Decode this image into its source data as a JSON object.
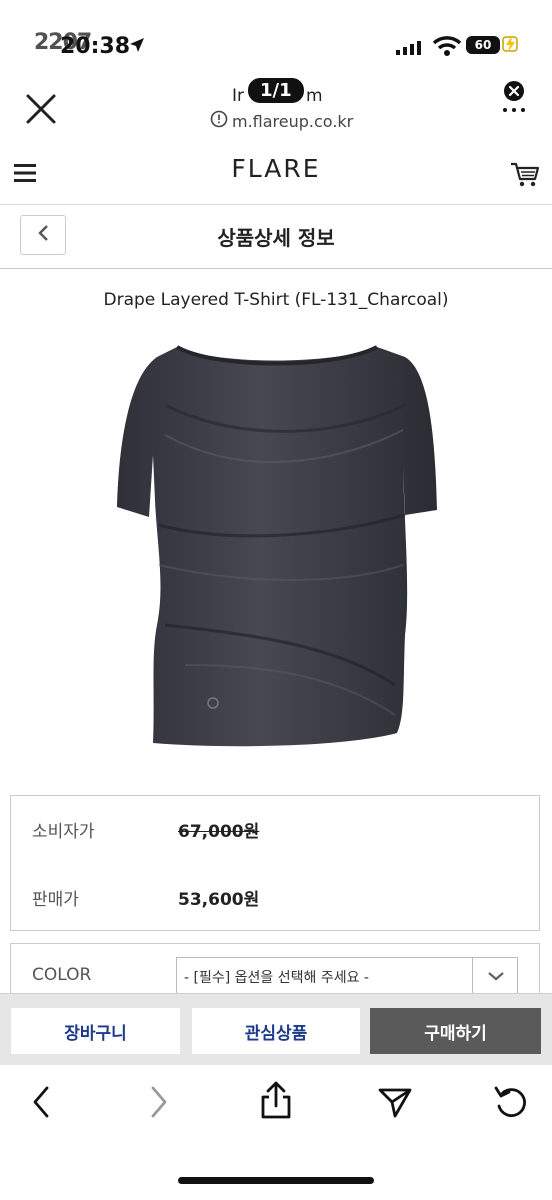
{
  "status_bar": {
    "time_ghost": "2207",
    "time": "20:38",
    "battery": "60"
  },
  "browser": {
    "title": "Ir",
    "title_tail": "m",
    "page_badge": "1/1",
    "url": "m.flareup.co.kr"
  },
  "header": {
    "brand": "FLARE",
    "sub_title": "상품상세 정보"
  },
  "product": {
    "name": "Drape Layered T-Shirt (FL-131_Charcoal)",
    "consumer_price_label": "소비자가",
    "consumer_price": "67,000원",
    "sale_price_label": "판매가",
    "sale_price": "53,600원",
    "option_label": "COLOR",
    "option_placeholder": "- [필수] 옵션을 선택해 주세요 -"
  },
  "actions": {
    "cart": "장바구니",
    "wishlist": "관심상품",
    "buy": "구매하기"
  },
  "icons": {
    "close": "close-icon",
    "menu": "hamburger-icon",
    "cart": "cart-icon",
    "back": "chevron-left-icon",
    "share": "share-icon",
    "send": "send-icon",
    "reload": "reload-icon"
  },
  "colors": {
    "accent_blue": "#1b3a8a",
    "buy_button": "#5a5a5a",
    "shirt": "#3b3c44"
  }
}
